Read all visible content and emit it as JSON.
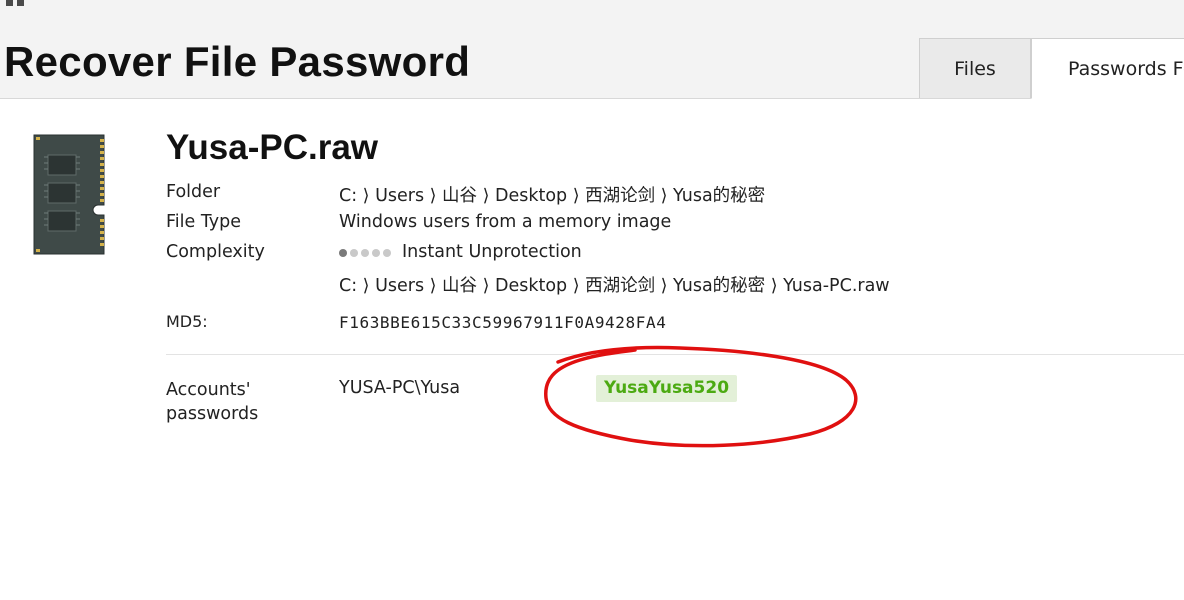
{
  "header": {
    "title": "Recover File Password",
    "tabs": [
      {
        "label": "Files"
      },
      {
        "label": "Passwords Fo"
      }
    ]
  },
  "file": {
    "name": "Yusa-PC.raw",
    "folder_label": "Folder",
    "folder_value": "C: ⟩ Users ⟩ 山谷 ⟩ Desktop ⟩ 西湖论剑 ⟩ Yusa的秘密",
    "type_label": "File Type",
    "type_value": "Windows users from a memory image",
    "complexity_label": "Complexity",
    "complexity_value": "Instant Unprotection",
    "complexity_level": 1,
    "complexity_max": 5,
    "path_value": "C: ⟩ Users ⟩ 山谷 ⟩ Desktop ⟩ 西湖论剑 ⟩ Yusa的秘密 ⟩ Yusa-PC.raw",
    "md5_label": "MD5:",
    "md5_value": "F163BBE615C33C59967911F0A9428FA4"
  },
  "accounts": {
    "label": "Accounts' passwords",
    "user": "YUSA-PC\\Yusa",
    "password": "YusaYusa520"
  },
  "colors": {
    "password_text": "#4caa12",
    "password_bg": "#e3f0d8",
    "annotation": "#e01010"
  },
  "icons": [
    "menu-icon",
    "back-arrow-icon",
    "forward-arrow-icon",
    "memory-chip-icon"
  ]
}
